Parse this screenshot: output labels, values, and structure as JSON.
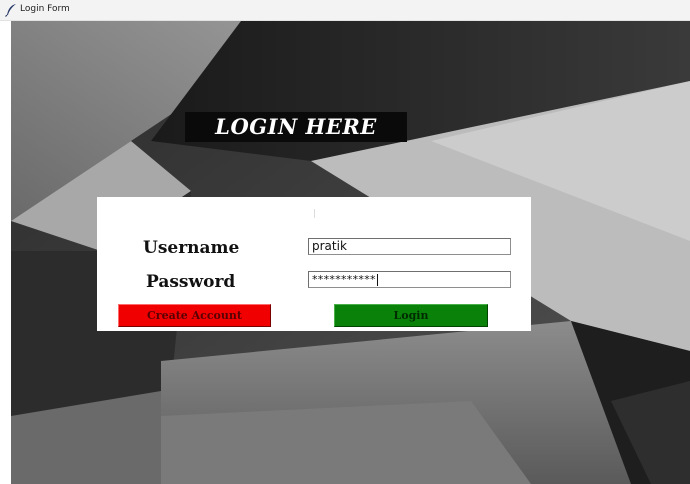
{
  "window": {
    "title": "Login Form",
    "icon": "feather-icon"
  },
  "heading": "LOGIN HERE",
  "form": {
    "username_label": "Username",
    "username_value": "pratik",
    "password_label": "Password",
    "password_value": "***********"
  },
  "buttons": {
    "create_account": "Create Account",
    "login": "Login"
  },
  "colors": {
    "create_account_bg": "#f00000",
    "login_bg": "#0a820a",
    "heading_bg": "#0a0a0a",
    "heading_fg": "#ffffff"
  }
}
